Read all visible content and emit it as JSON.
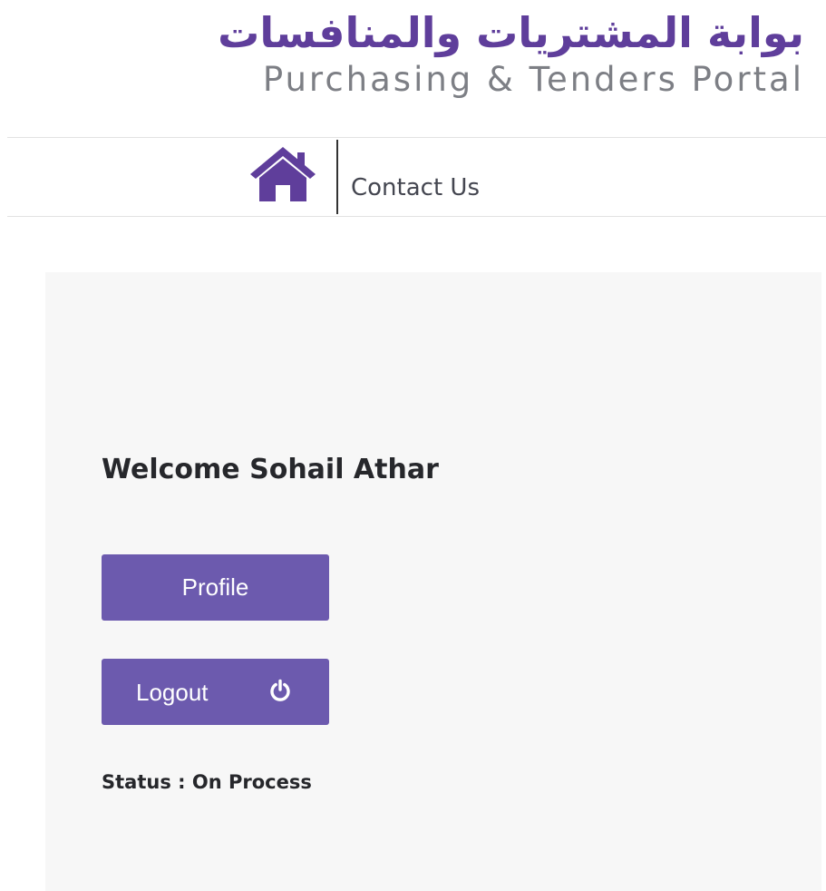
{
  "header": {
    "title_arabic": "بوابة المشتريات والمنافسات",
    "title_english": "Purchasing & Tenders Portal"
  },
  "nav": {
    "home_icon": "home-icon",
    "contact_label": "Contact Us"
  },
  "main": {
    "welcome_text": "Welcome Sohail Athar",
    "profile_label": "Profile",
    "logout_label": "Logout",
    "logout_icon": "power-icon",
    "status_text": "Status : On Process"
  },
  "colors": {
    "brand_purple": "#5f3e9b",
    "button_purple": "#6c5aae",
    "subtitle_gray": "#7d7f85",
    "panel_bg": "#f7f7f7"
  }
}
